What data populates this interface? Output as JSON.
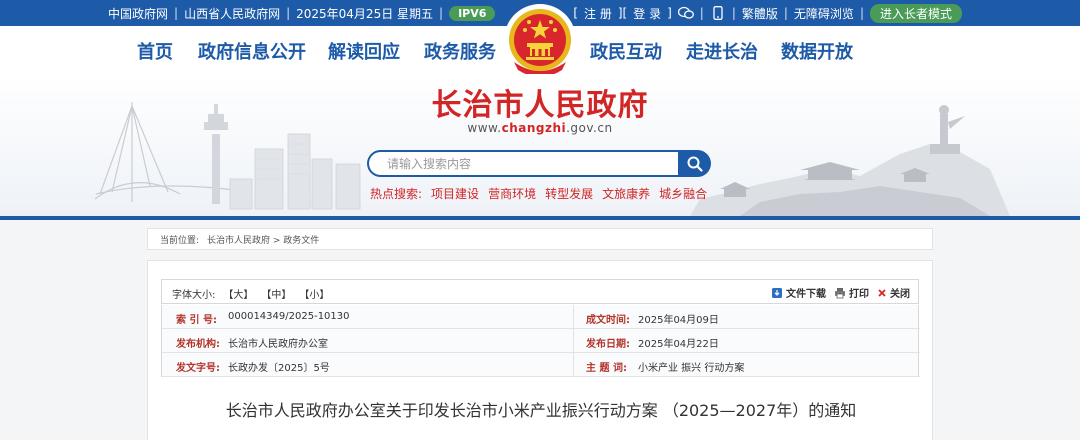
{
  "topbar": {
    "links_left": [
      "中国政府网",
      "山西省人民政府网"
    ],
    "date": "2025年04月25日 星期五",
    "ipv6": "IPV6",
    "register": "注 册",
    "login": "登 录",
    "traditional": "繁體版",
    "accessible": "无障碍浏览",
    "elder_mode": "进入长者模式"
  },
  "nav": {
    "items": [
      "首页",
      "政府信息公开",
      "解读回应",
      "政务服务",
      "政民互动",
      "走进长治",
      "数据开放"
    ]
  },
  "banner": {
    "site_title": "长治市人民政府",
    "url_prefix": "www.",
    "url_domain": "changzhi",
    "url_suffix": ".gov.cn",
    "search_placeholder": "请输入搜索内容",
    "hot_label": "热点搜索:",
    "hot_items": [
      "项目建设",
      "营商环境",
      "转型发展",
      "文旅康养",
      "城乡融合"
    ]
  },
  "breadcrumb": {
    "label": "当前位置:",
    "path": "长治市人民政府 > 政务文件"
  },
  "toolbar": {
    "font_label": "字体大小:",
    "font_large": "【大】",
    "font_medium": "【中】",
    "font_small": "【小】",
    "download": "文件下载",
    "print": "打印",
    "close": "关闭"
  },
  "meta": {
    "index_label": "索 引 号:",
    "index_value": "000014349/2025-10130",
    "date_created_label": "成文时间:",
    "date_created_value": "2025年04月09日",
    "issuer_label": "发布机构:",
    "issuer_value": "长治市人民政府办公室",
    "pub_date_label": "发布日期:",
    "pub_date_value": "2025年04月22日",
    "doc_no_label": "发文字号:",
    "doc_no_value": "长政办发〔2025〕5号",
    "subject_label": "主 题 词:",
    "subject_value": "小米产业 振兴 行动方案"
  },
  "document": {
    "title": "长治市人民政府办公室关于印发长治市小米产业振兴行动方案 （2025—2027年）的通知"
  },
  "colors": {
    "brand_blue": "#1d5aa7",
    "title_red": "#d22525",
    "badge_green": "#4a9b57"
  }
}
